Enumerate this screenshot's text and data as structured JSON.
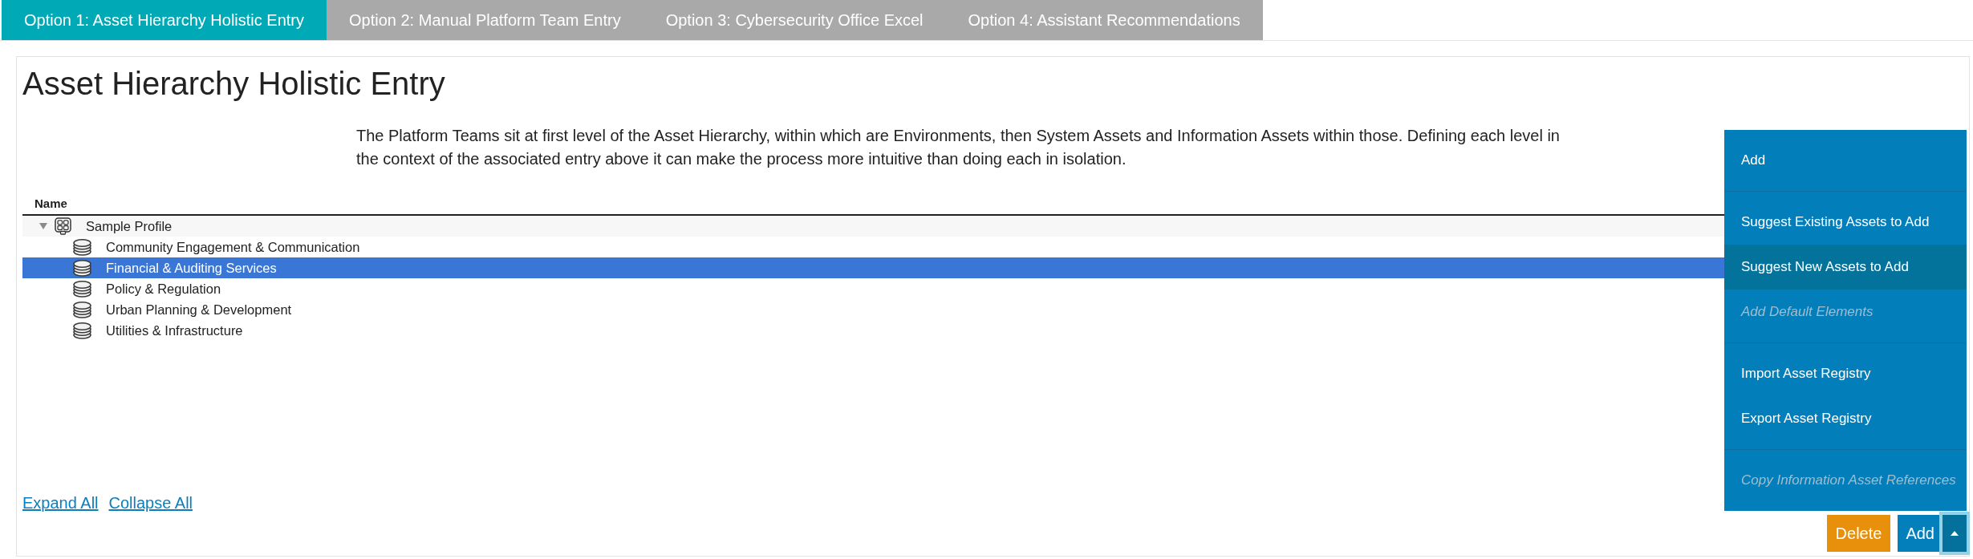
{
  "tabs": [
    {
      "label": "Option 1: Asset Hierarchy Holistic Entry",
      "selected": true
    },
    {
      "label": "Option 2: Manual Platform Team Entry",
      "selected": false
    },
    {
      "label": "Option 3: Cybersecurity Office Excel",
      "selected": false
    },
    {
      "label": "Option 4: Assistant Recommendations",
      "selected": false
    }
  ],
  "panel": {
    "title": "Asset Hierarchy Holistic Entry",
    "description": "The Platform Teams sit at first level of the Asset Hierarchy, within which are Environments, then System Assets and Information Assets within those. Defining each level in the context of the associated entry above it can make the process more intuitive than doing each in isolation."
  },
  "tree": {
    "column": "Name",
    "nodes": [
      {
        "label": "Sample Profile",
        "kind": "profile",
        "expanded": true,
        "selected": false,
        "children": [
          {
            "label": "Community Engagement & Communication",
            "kind": "asset_group",
            "selected": false
          },
          {
            "label": "Financial & Auditing Services",
            "kind": "asset_group",
            "selected": true
          },
          {
            "label": "Policy & Regulation",
            "kind": "asset_group",
            "selected": false
          },
          {
            "label": "Urban Planning & Development",
            "kind": "asset_group",
            "selected": false
          },
          {
            "label": "Utilities & Infrastructure",
            "kind": "asset_group",
            "selected": false
          }
        ]
      }
    ],
    "links": [
      "Expand All",
      "Collapse All"
    ]
  },
  "menu": {
    "groups": [
      {
        "items": [
          {
            "label": "Add",
            "selected": false,
            "disabled": false
          }
        ]
      },
      {
        "items": [
          {
            "label": "Suggest Existing Assets to Add",
            "selected": false,
            "disabled": false
          },
          {
            "label": "Suggest New Assets to Add",
            "selected": true,
            "disabled": false
          },
          {
            "label": "Add Default Elements",
            "selected": false,
            "disabled": true
          }
        ]
      },
      {
        "items": [
          {
            "label": "Import Asset Registry",
            "selected": false,
            "disabled": false
          },
          {
            "label": "Export Asset Registry",
            "selected": false,
            "disabled": false
          }
        ]
      },
      {
        "items": [
          {
            "label": "Copy Information Asset References",
            "selected": false,
            "disabled": true
          }
        ]
      }
    ]
  },
  "actions": {
    "delete": "Delete",
    "add": "Add",
    "menu_open": true
  }
}
